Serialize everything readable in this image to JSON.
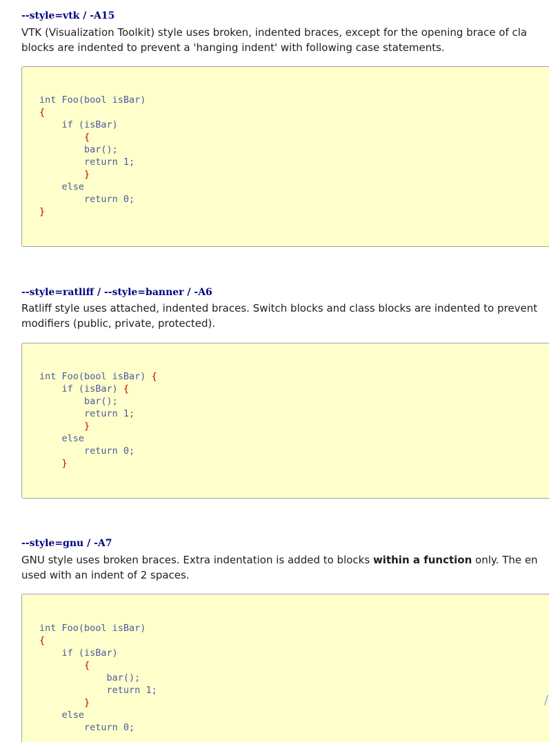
{
  "sections": [
    {
      "title": "--style=vtk / -A15",
      "description_lines": [
        "VTK (Visualization Toolkit) style uses broken, indented braces, except for the opening brace of cla",
        "blocks are indented to prevent a 'hanging indent' with following case statements."
      ],
      "code_lines": [
        {
          "indent": "",
          "text": "int Foo(bool isBar)",
          "brace": false
        },
        {
          "indent": "",
          "text": "{",
          "brace": true
        },
        {
          "indent": "    ",
          "text": "if (isBar)",
          "brace": false
        },
        {
          "indent": "        ",
          "text": "{",
          "brace": true
        },
        {
          "indent": "        ",
          "text": "bar();",
          "brace": false
        },
        {
          "indent": "        ",
          "text": "return 1;",
          "brace": false
        },
        {
          "indent": "        ",
          "text": "}",
          "brace": true
        },
        {
          "indent": "    ",
          "text": "else",
          "brace": false
        },
        {
          "indent": "        ",
          "text": "return 0;",
          "brace": false
        },
        {
          "indent": "",
          "text": "}",
          "brace": true
        }
      ]
    },
    {
      "title": "--style=ratliff / --style=banner / -A6",
      "description_lines": [
        "Ratliff style uses attached, indented braces. Switch blocks and class blocks are indented to prevent",
        "modifiers (public, private, protected)."
      ],
      "code_lines": [
        {
          "indent": "",
          "text": "int Foo(bool isBar) ",
          "tail": "{"
        },
        {
          "indent": "    ",
          "text": "if (isBar) ",
          "tail": "{"
        },
        {
          "indent": "        ",
          "text": "bar();",
          "brace": false
        },
        {
          "indent": "        ",
          "text": "return 1;",
          "brace": false
        },
        {
          "indent": "        ",
          "text": "}",
          "brace": true
        },
        {
          "indent": "    ",
          "text": "else",
          "brace": false
        },
        {
          "indent": "        ",
          "text": "return 0;",
          "brace": false
        },
        {
          "indent": "    ",
          "text": "}",
          "brace": true
        }
      ]
    },
    {
      "title": "--style=gnu / -A7",
      "description_parts": {
        "line1_before": "GNU style uses broken braces. Extra indentation is added to blocks ",
        "line1_bold": "within a function",
        "line1_after": " only. The en",
        "line2": "used with an indent of 2 spaces."
      },
      "code_lines": [
        {
          "indent": "",
          "text": "int Foo(bool isBar)",
          "brace": false
        },
        {
          "indent": "",
          "text": "{",
          "brace": true
        },
        {
          "indent": "    ",
          "text": "if (isBar)",
          "brace": false
        },
        {
          "indent": "        ",
          "text": "{",
          "brace": true
        },
        {
          "indent": "            ",
          "text": "bar();",
          "brace": false
        },
        {
          "indent": "            ",
          "text": "return 1;",
          "brace": false
        },
        {
          "indent": "        ",
          "text": "}",
          "brace": true
        },
        {
          "indent": "    ",
          "text": "else",
          "brace": false
        },
        {
          "indent": "        ",
          "text": "return 0;",
          "brace": false
        }
      ]
    }
  ]
}
